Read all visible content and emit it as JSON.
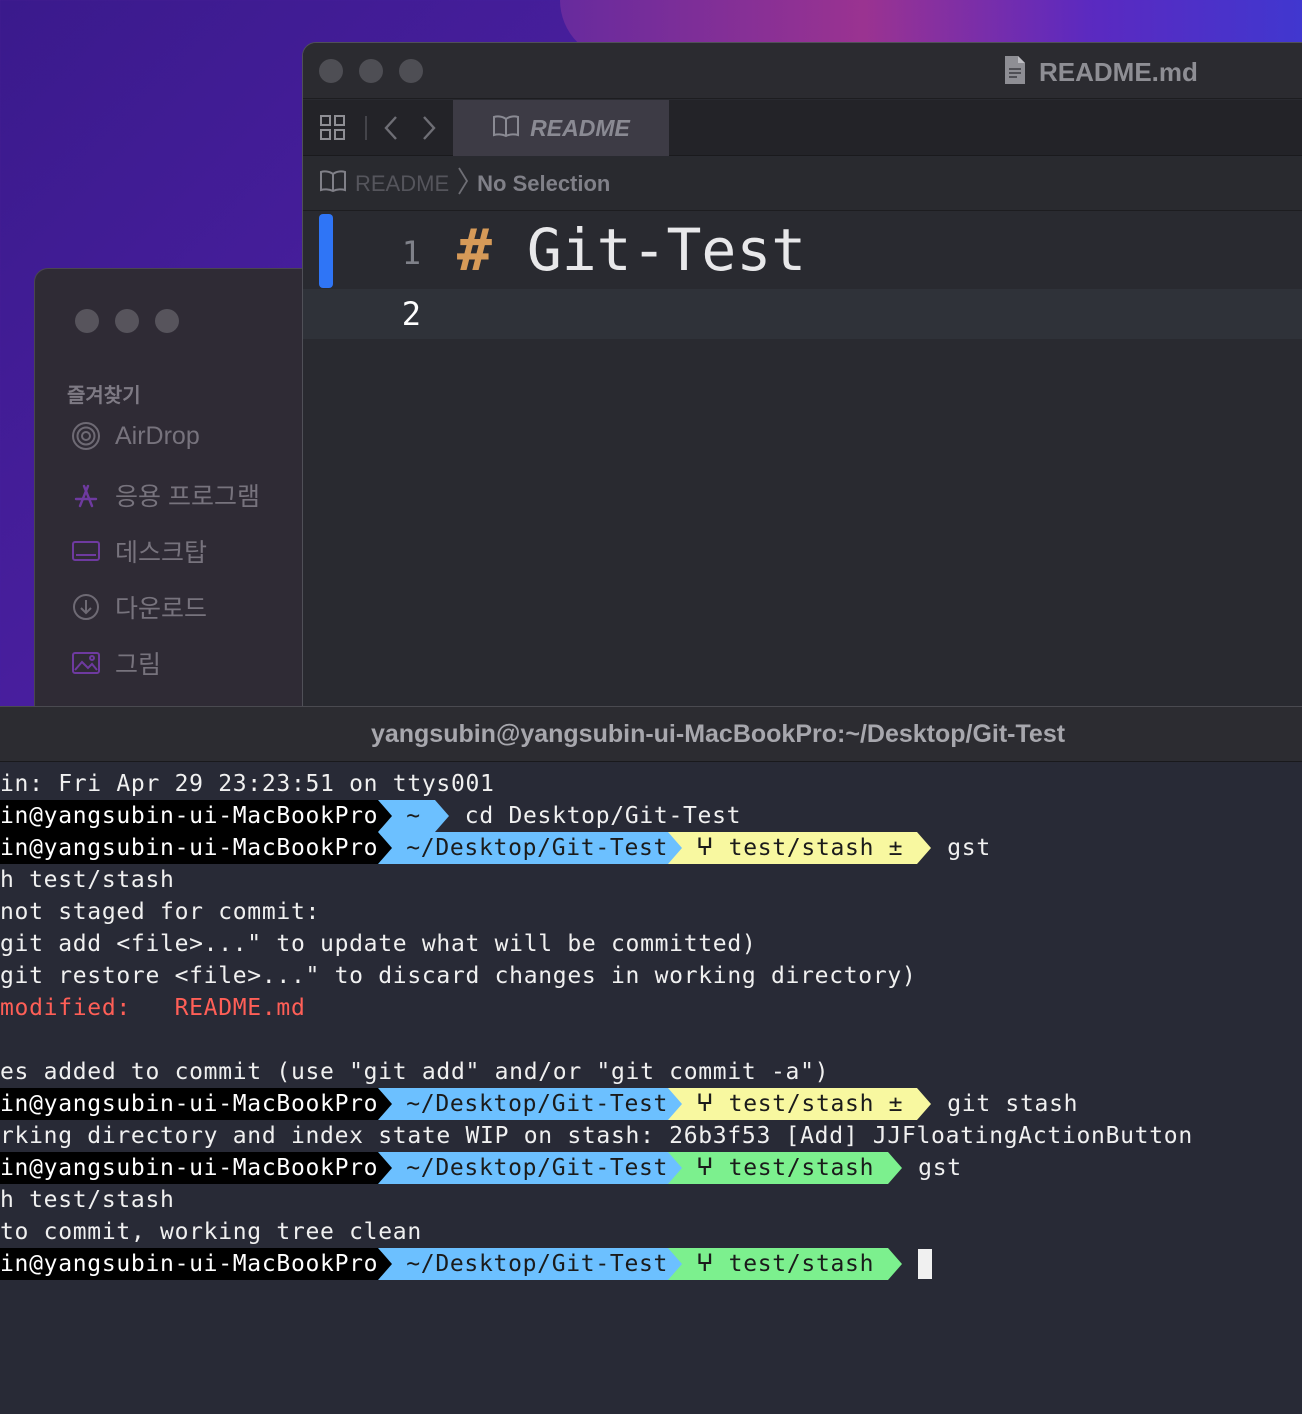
{
  "finder": {
    "favorites_title": "즐겨찾기",
    "items": [
      {
        "label": "AirDrop",
        "icon": "airdrop-icon"
      },
      {
        "label": "응용 프로그램",
        "icon": "applications-icon"
      },
      {
        "label": "데스크탑",
        "icon": "desktop-icon"
      },
      {
        "label": "다운로드",
        "icon": "download-icon"
      },
      {
        "label": "그림",
        "icon": "pictures-icon"
      }
    ]
  },
  "xcode": {
    "window_title": "README.md",
    "tab_label": "README",
    "breadcrumb": {
      "file": "README",
      "selection": "No Selection"
    },
    "lines": [
      {
        "number": "1",
        "hash": "#",
        "text": " Git-Test"
      },
      {
        "number": "2",
        "hash": "",
        "text": ""
      }
    ]
  },
  "terminal": {
    "title": "yangsubin@yangsubin-ui-MacBookPro:~/Desktop/Git-Test",
    "lines": {
      "l0": "in: Fri Apr 29 23:23:51 on ttys001",
      "p1_user": "in@yangsubin-ui-MacBookPro",
      "p1_dir": "~",
      "p1_cmd": "cd Desktop/Git-Test",
      "p2_user": "in@yangsubin-ui-MacBookPro",
      "p2_dir": "~/Desktop/Git-Test",
      "p2_git": "test/stash ±",
      "p2_cmd": "gst",
      "l3": "h test/stash",
      "l4": "not staged for commit:",
      "l5": "git add <file>...\" to update what will be committed)",
      "l6": "git restore <file>...\" to discard changes in working directory)",
      "l7": "modified:   README.md",
      "l8": "es added to commit (use \"git add\" and/or \"git commit -a\")",
      "p3_user": "in@yangsubin-ui-MacBookPro",
      "p3_dir": "~/Desktop/Git-Test",
      "p3_git": "test/stash ±",
      "p3_cmd": "git stash",
      "l9": "rking directory and index state WIP on stash: 26b3f53 [Add] JJFloatingActionButton",
      "p4_user": "in@yangsubin-ui-MacBookPro",
      "p4_dir": "~/Desktop/Git-Test",
      "p4_git": "test/stash",
      "p4_cmd": "gst",
      "l10": "h test/stash",
      "l11": "to commit, working tree clean",
      "p5_user": "in@yangsubin-ui-MacBookPro",
      "p5_dir": "~/Desktop/Git-Test",
      "p5_git": "test/stash"
    },
    "branch_glyph": "ⵖ"
  },
  "colors": {
    "prompt_dir": "#6cc0ff",
    "prompt_git_dirty": "#f8f8a0",
    "prompt_git_clean": "#7cf08e",
    "modified_red": "#ff5f57",
    "change_bar": "#2f75f6",
    "markdown_hash": "#d69a58"
  }
}
